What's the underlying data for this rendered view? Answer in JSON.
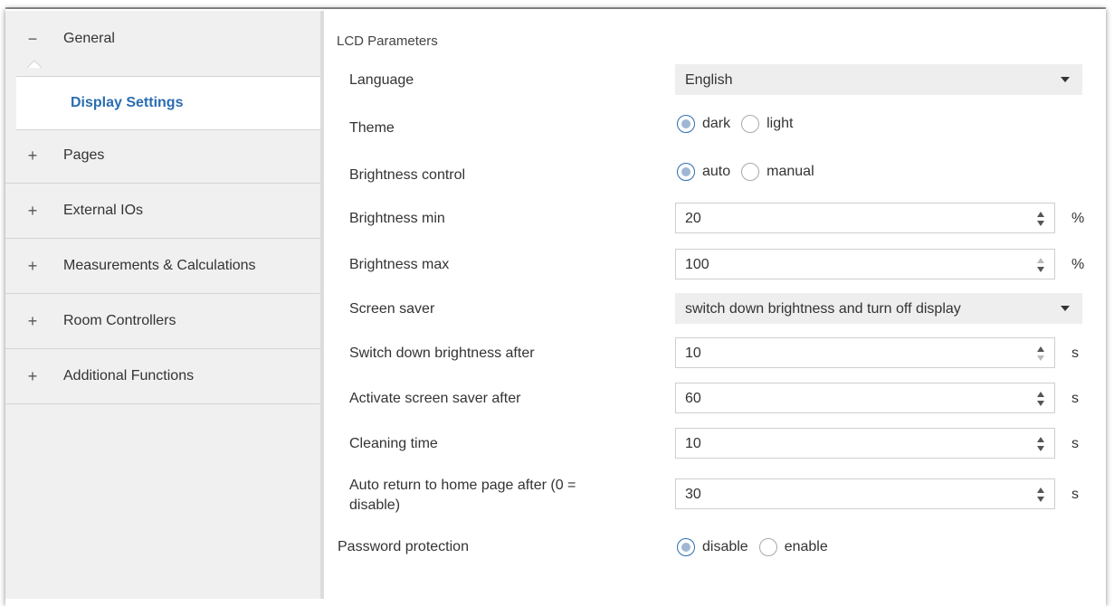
{
  "sidebar": {
    "general": {
      "sign": "−",
      "label": "General"
    },
    "sub_item": {
      "label": "Display Settings"
    },
    "items": [
      {
        "sign": "+",
        "label": "Pages"
      },
      {
        "sign": "+",
        "label": "External IOs"
      },
      {
        "sign": "+",
        "label": "Measurements & Calculations"
      },
      {
        "sign": "+",
        "label": "Room Controllers"
      },
      {
        "sign": "+",
        "label": "Additional Functions"
      }
    ]
  },
  "main": {
    "section_title": "LCD Parameters",
    "language": {
      "label": "Language",
      "value": "English"
    },
    "theme": {
      "label": "Theme",
      "options": [
        "dark",
        "light"
      ],
      "selected": "dark"
    },
    "brightness_control": {
      "label": "Brightness control",
      "options": [
        "auto",
        "manual"
      ],
      "selected": "auto"
    },
    "brightness_min": {
      "label": "Brightness min",
      "value": "20",
      "unit": "%"
    },
    "brightness_max": {
      "label": "Brightness max",
      "value": "100",
      "unit": "%"
    },
    "screen_saver": {
      "label": "Screen saver",
      "value": "switch down brightness and turn off display"
    },
    "switch_down": {
      "label": "Switch down brightness after",
      "value": "10",
      "unit": "s"
    },
    "activate_saver": {
      "label": "Activate screen saver after",
      "value": "60",
      "unit": "s"
    },
    "cleaning_time": {
      "label": "Cleaning time",
      "value": "10",
      "unit": "s"
    },
    "auto_return": {
      "label_line1": "Auto return to home page after (0 =",
      "label_line2": "disable)",
      "value": "30",
      "unit": "s"
    },
    "password_protection": {
      "label": "Password protection",
      "options": [
        "disable",
        "enable"
      ],
      "selected": "disable"
    }
  },
  "colors": {
    "accent": "#2a6db1",
    "sidebar_bg": "#f0f0f0",
    "select_bg": "#eeeeee"
  }
}
